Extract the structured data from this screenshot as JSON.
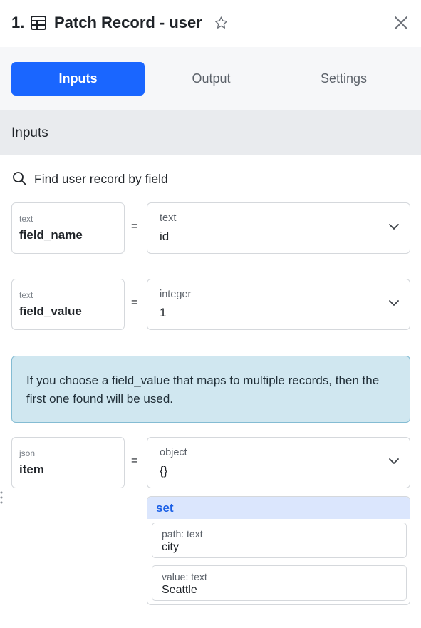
{
  "header": {
    "step_number": "1.",
    "title": "Patch Record - user",
    "icon": "table-icon"
  },
  "tabs": [
    {
      "label": "Inputs",
      "active": true
    },
    {
      "label": "Output",
      "active": false
    },
    {
      "label": "Settings",
      "active": false
    }
  ],
  "section": {
    "title": "Inputs"
  },
  "search_hint": "Find user record by field",
  "fields": [
    {
      "name_type": "text",
      "name": "field_name",
      "value_type": "text",
      "value": "id"
    },
    {
      "name_type": "text",
      "name": "field_value",
      "value_type": "integer",
      "value": "1"
    },
    {
      "name_type": "json",
      "name": "item",
      "value_type": "object",
      "value": "{}"
    }
  ],
  "equals": "=",
  "info_message": "If you choose a field_value that maps to multiple records, then the first one found will be used.",
  "set_panel": {
    "label": "set",
    "path": {
      "type_label": "path: text",
      "value": "city"
    },
    "value": {
      "type_label": "value: text",
      "value": "Seattle"
    }
  },
  "colors": {
    "accent": "#1a66ff",
    "info_bg": "#d0e7f0",
    "info_border": "#84bcd3",
    "set_header_bg": "#dbe6fd",
    "set_label": "#1a5fe6"
  }
}
